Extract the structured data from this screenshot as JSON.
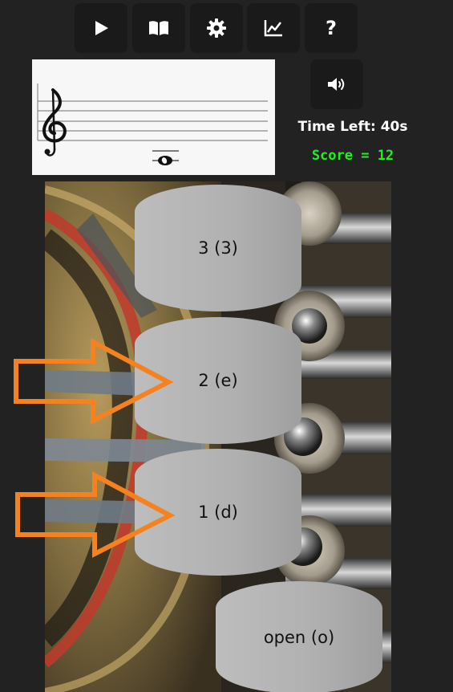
{
  "toolbar": {
    "buttons": [
      {
        "name": "play",
        "icon": "play-icon"
      },
      {
        "name": "book",
        "icon": "book-icon"
      },
      {
        "name": "settings",
        "icon": "gear-icon"
      },
      {
        "name": "stats",
        "icon": "chart-icon"
      },
      {
        "name": "help",
        "icon": "question-icon",
        "glyph": "?"
      }
    ]
  },
  "staff": {
    "clef": "treble-clef",
    "note": "whole-note-ledger-below"
  },
  "status": {
    "time_left": "Time Left: 40s",
    "score": "Score = 12"
  },
  "colors": {
    "background": "#222222",
    "score_text": "#22ee22",
    "arrow": "#f58220",
    "valve_button": "#b4b4b4"
  },
  "valves": {
    "v3": "3 (3)",
    "v2": "2 (e)",
    "v1": "1 (d)",
    "open": "open (o)"
  },
  "hints": {
    "highlighted_valves": [
      "2 (e)",
      "1 (d)"
    ]
  }
}
